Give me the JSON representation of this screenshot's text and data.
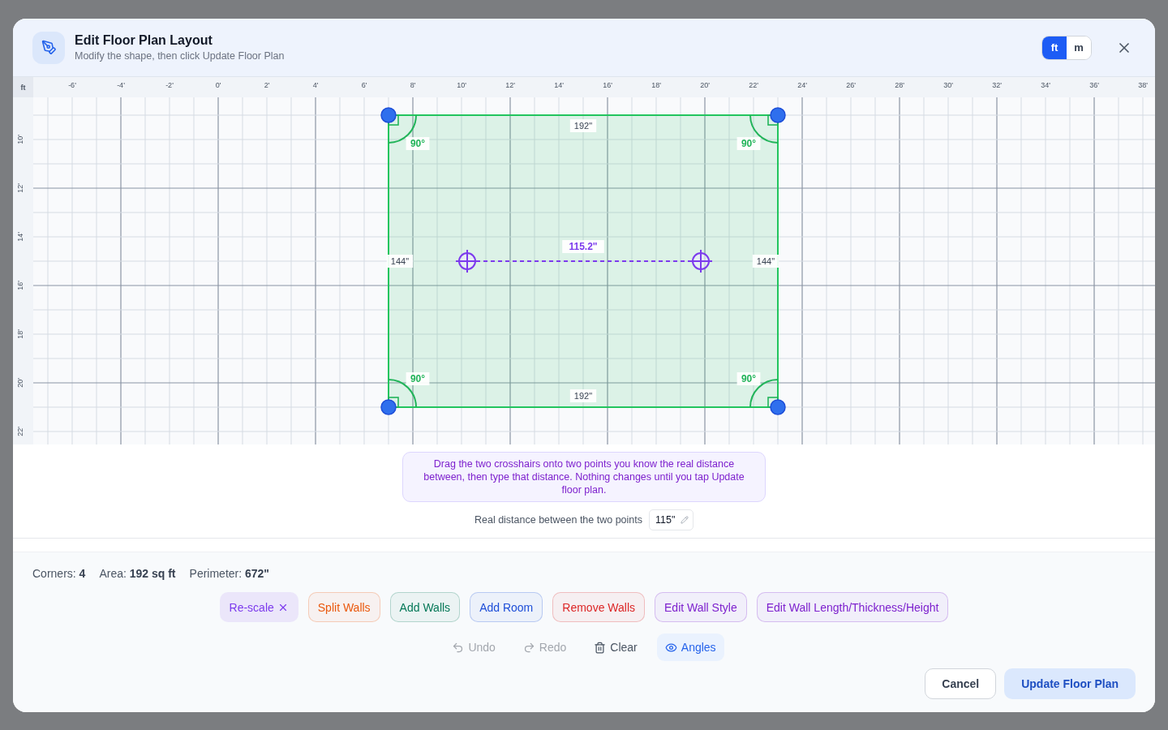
{
  "dialog": {
    "title": "Edit Floor Plan Layout",
    "subtitle": "Modify the shape, then click Update Floor Plan",
    "units": [
      {
        "label": "ft",
        "selected": true
      },
      {
        "label": "m",
        "selected": false
      }
    ]
  },
  "canvas": {
    "unit_label": "ft",
    "x_ruler": [
      "-6'",
      "-4'",
      "-2'",
      "0'",
      "2'",
      "4'",
      "6'",
      "8'",
      "10'",
      "12'",
      "14'",
      "16'",
      "18'",
      "20'",
      "22'",
      "24'",
      "26'",
      "28'",
      "30'",
      "32'",
      "34'",
      "36'",
      "38'"
    ],
    "y_ruler": [
      "10'",
      "12'",
      "14'",
      "16'",
      "18'",
      "20'",
      "22'"
    ],
    "wall_labels": [
      "192\"",
      "144\"",
      "192\"",
      "144\""
    ],
    "angle_labels": [
      "90°",
      "90°",
      "90°",
      "90°"
    ],
    "measure_label": "115.2\""
  },
  "hint": "Drag the two crosshairs onto two points you know the real distance between, then type that distance. Nothing changes until you tap Update floor plan.",
  "distance": {
    "label": "Real distance between the two points",
    "value": "115\""
  },
  "stats": [
    "Corners: **4**",
    "Area: **192 sq ft**",
    "Perimeter: **672\"**"
  ],
  "tools": [
    {
      "label": "Re-scale",
      "selected": true,
      "color": "#7c3aed"
    },
    {
      "label": "Split Walls",
      "selected": false,
      "color": "#ea580c"
    },
    {
      "label": "Add Walls",
      "selected": false,
      "color": "#047857"
    },
    {
      "label": "Add Room",
      "selected": false,
      "color": "#1d4ed8"
    },
    {
      "label": "Remove Walls",
      "selected": false,
      "color": "#dc2626"
    },
    {
      "label": "Edit Wall Style",
      "selected": false,
      "color": "#7e22ce"
    },
    {
      "label": "Edit Wall Length/Thickness/Height",
      "selected": false,
      "color": "#7e22ce"
    }
  ],
  "actions": [
    {
      "kind": "undo",
      "label": "Undo",
      "disabled": true,
      "on": false
    },
    {
      "kind": "redo",
      "label": "Redo",
      "disabled": true,
      "on": false
    },
    {
      "kind": "clear",
      "label": "Clear",
      "disabled": false,
      "on": false
    },
    {
      "kind": "angles",
      "label": "Angles",
      "disabled": false,
      "on": true
    }
  ],
  "footer": [
    {
      "kind": "secondary",
      "label": "Cancel",
      "disabled": false
    },
    {
      "kind": "primary",
      "label": "Update Floor Plan",
      "disabled": true
    }
  ]
}
